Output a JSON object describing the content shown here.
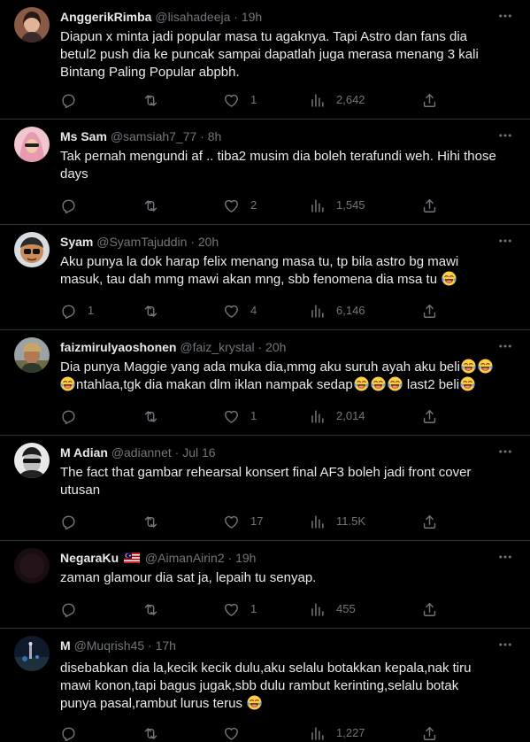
{
  "tweets": [
    {
      "name": "AnggerikRimba",
      "handle": "@lisahadeeja",
      "time": "19h",
      "text_lines": [
        "Diapun x minta jadi popular masa tu agaknya. Tapi Astro dan fans dia",
        "betul2 push dia ke puncak sampai dapatlah juga merasa menang 3 kali",
        "Bintang Paling Popular abpbh."
      ],
      "replies": "",
      "retweets": "",
      "likes": "1",
      "views": "2,642"
    },
    {
      "name": "Ms Sam",
      "handle": "@samsiah7_77",
      "time": "8h",
      "text_lines": [
        "Tak pernah mengundi af .. tiba2 musim dia boleh terafundi weh. Hihi those",
        "days"
      ],
      "replies": "",
      "retweets": "",
      "likes": "2",
      "views": "1,545"
    },
    {
      "name": "Syam",
      "handle": "@SyamTajuddin",
      "time": "20h",
      "text_lines": [
        "Aku punya la dok harap felix menang masa tu, tp bila astro bg mawi",
        "masuk, tau dah mmg mawi akan mng, sbb fenomena dia msa tu"
      ],
      "replies": "1",
      "retweets": "",
      "likes": "4",
      "views": "6,146"
    },
    {
      "name": "faizmirulyaoshonen",
      "handle": "@faiz_krystal",
      "time": "20h",
      "text_lines": [
        "Dia punya Maggie yang ada muka dia,mmg aku suruh ayah aku beli",
        "ntahlaa,tgk dia makan dlm iklan nampak sedap",
        "last2 beli"
      ],
      "replies": "",
      "retweets": "",
      "likes": "1",
      "views": "2,014"
    },
    {
      "name": "M Adian",
      "handle": "@adiannet",
      "time": "Jul 16",
      "text_lines": [
        "The fact that gambar rehearsal konsert final AF3 boleh jadi front cover",
        "utusan"
      ],
      "replies": "",
      "retweets": "",
      "likes": "17",
      "views": "11.5K"
    },
    {
      "name": "NegaraKu",
      "handle": "@AimanAirin2",
      "time": "19h",
      "text_lines": [
        "zaman glamour dia sat ja, lepaih tu senyap."
      ],
      "replies": "",
      "retweets": "",
      "likes": "1",
      "views": "455"
    },
    {
      "name": "M",
      "handle": "@Muqrish45",
      "time": "17h",
      "text_lines": [
        "disebabkan dia la,kecik kecik dulu,aku selalu botakkan kepala,nak tiru",
        "mawi konon,tapi bagus jugak,sbb dulu rambut kerinting,selalu botak",
        "punya pasal,rambut lurus terus"
      ],
      "replies": "",
      "retweets": "",
      "likes": "",
      "views": "1,227"
    }
  ],
  "separator": "·",
  "icons": {
    "more": "more-icon",
    "reply": "reply-icon",
    "retweet": "retweet-icon",
    "like": "heart-icon",
    "views": "views-icon",
    "share": "share-icon",
    "emoji": "laughing-tears-emoji",
    "flag": "malaysia-flag-icon"
  },
  "colors": {
    "background": "#000000",
    "text": "#e7e9ea",
    "secondary": "#71767b",
    "divider": "#2f3336"
  }
}
